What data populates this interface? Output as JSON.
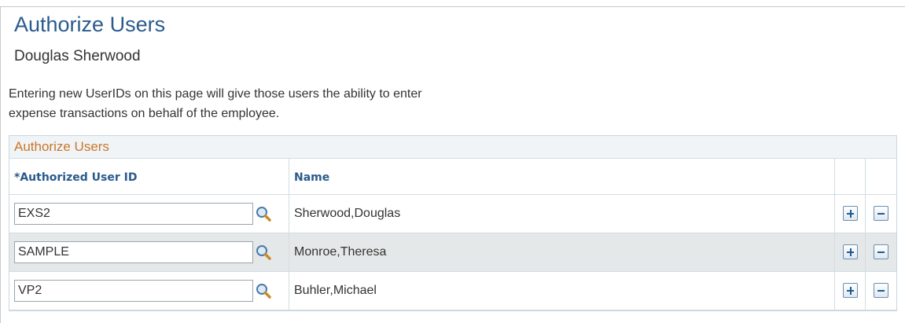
{
  "page": {
    "title": "Authorize Users",
    "employee_name": "Douglas Sherwood",
    "instructions_line1": "Entering new UserIDs on this page will give those users the ability to enter",
    "instructions_line2": "expense transactions on behalf of the employee."
  },
  "grid": {
    "title": "Authorize Users",
    "headers": {
      "user_id": "*Authorized User ID",
      "name": "Name"
    },
    "rows": [
      {
        "user_id": "EXS2",
        "name": "Sherwood,Douglas"
      },
      {
        "user_id": "SAMPLE",
        "name": "Monroe,Theresa"
      },
      {
        "user_id": "VP2",
        "name": "Buhler,Michael"
      }
    ]
  },
  "icons": {
    "lookup": "magnifier-icon",
    "add_row": "plus-icon",
    "delete_row": "minus-icon"
  },
  "colors": {
    "title": "#2a5a8c",
    "grid_title": "#c9772b",
    "header_text": "#2a5a8c",
    "alt_row": "#e5e8e8"
  }
}
